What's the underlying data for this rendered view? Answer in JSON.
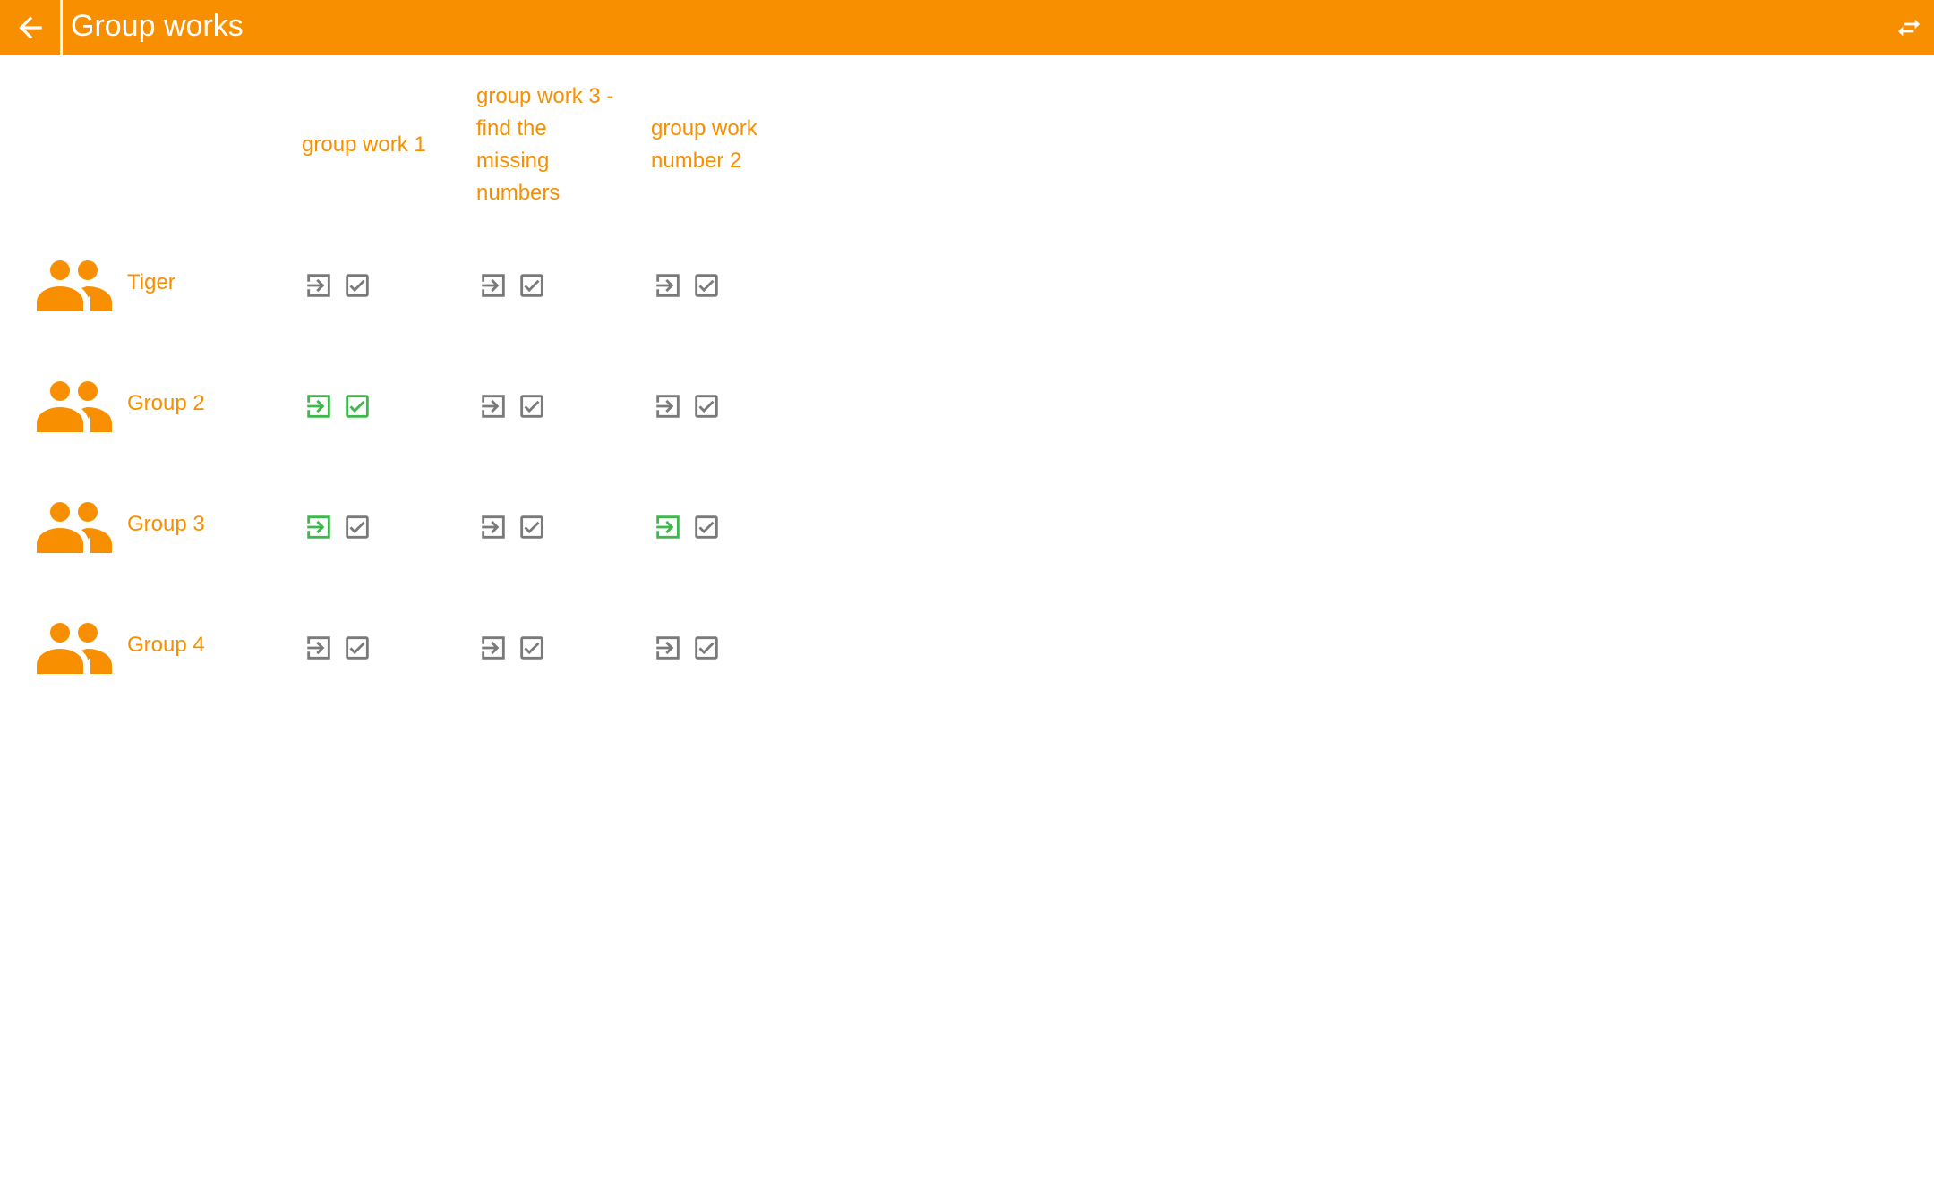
{
  "app": {
    "title": "Group works",
    "accent_color": "#f78f00",
    "done_color": "#3db84a",
    "pending_color": "#7a7a7a"
  },
  "header": {
    "back_icon": "arrow-left-icon",
    "switch_icon": "swap-arrows-icon"
  },
  "columns": [
    {
      "label": "group work 1"
    },
    {
      "label": "group work 3 -\nfind the\nmissing\nnumbers"
    },
    {
      "label": "group work\nnumber 2"
    }
  ],
  "groups": [
    {
      "name": "Tiger",
      "icon": "group-people-icon",
      "works": [
        {
          "submit_done": false,
          "check_done": false
        },
        {
          "submit_done": false,
          "check_done": false
        },
        {
          "submit_done": false,
          "check_done": false
        }
      ]
    },
    {
      "name": "Group 2",
      "icon": "group-people-icon",
      "works": [
        {
          "submit_done": true,
          "check_done": true
        },
        {
          "submit_done": false,
          "check_done": false
        },
        {
          "submit_done": false,
          "check_done": false
        }
      ]
    },
    {
      "name": "Group 3",
      "icon": "group-people-icon",
      "works": [
        {
          "submit_done": true,
          "check_done": false
        },
        {
          "submit_done": false,
          "check_done": false
        },
        {
          "submit_done": true,
          "check_done": false
        }
      ]
    },
    {
      "name": "Group 4",
      "icon": "group-people-icon",
      "works": [
        {
          "submit_done": false,
          "check_done": false
        },
        {
          "submit_done": false,
          "check_done": false
        },
        {
          "submit_done": false,
          "check_done": false
        }
      ]
    }
  ]
}
